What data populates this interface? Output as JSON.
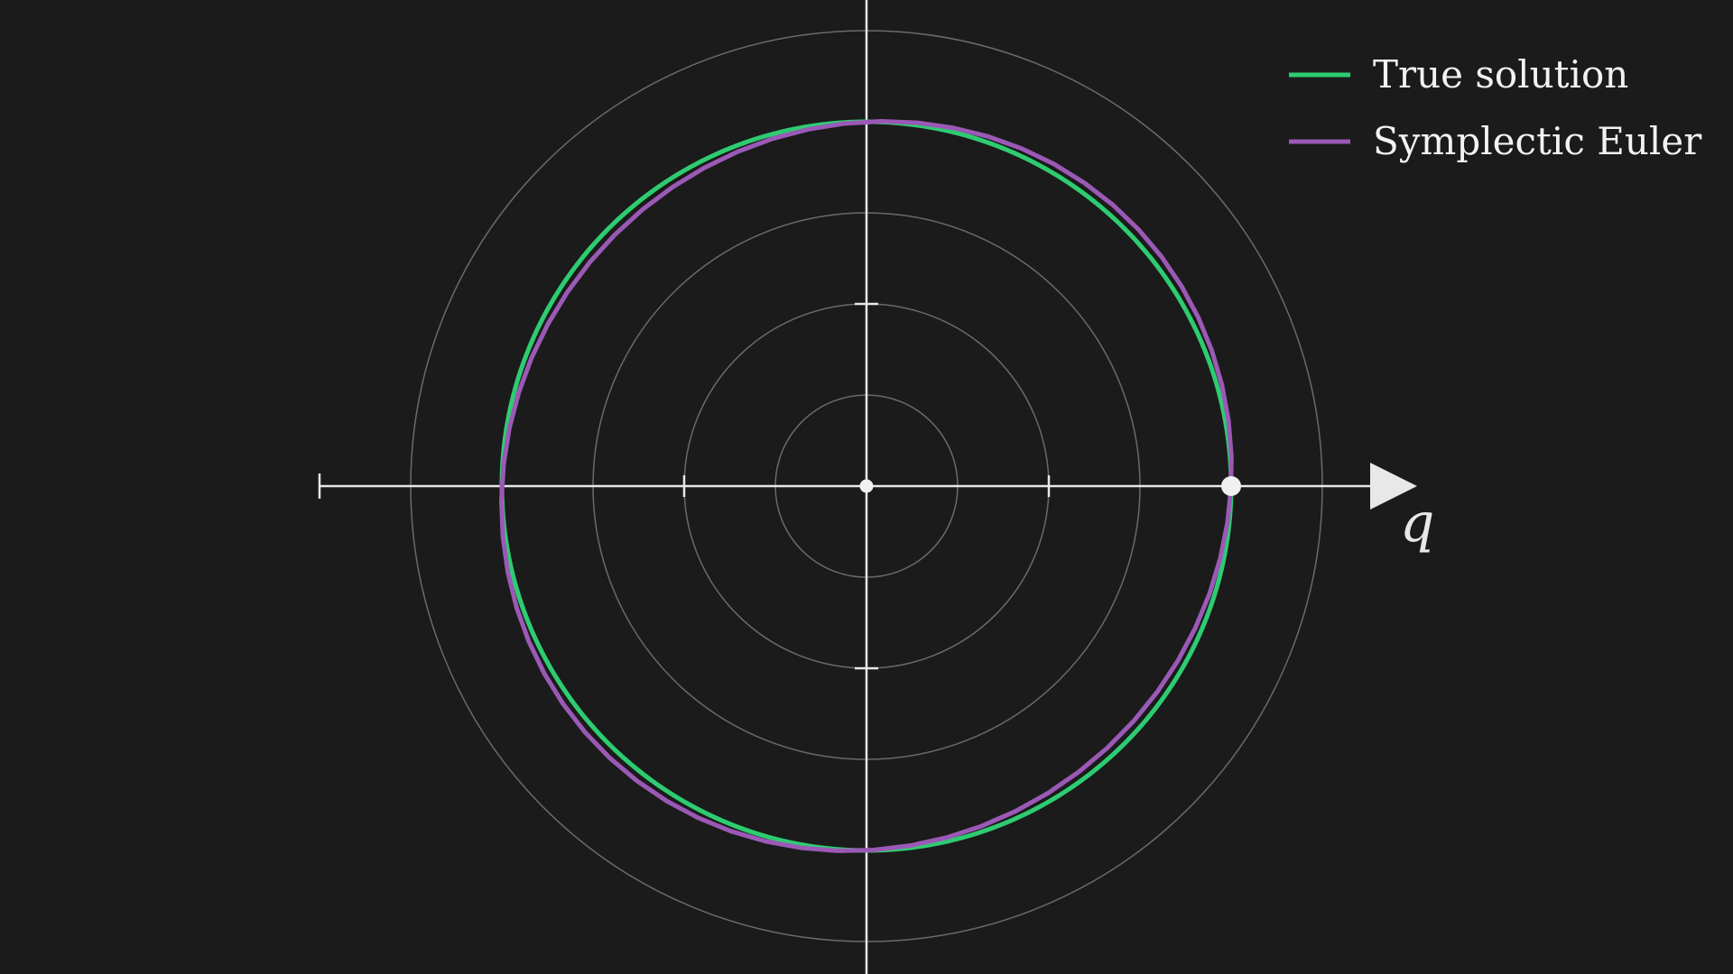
{
  "chart_data": {
    "type": "line",
    "title": "",
    "xlabel": "q",
    "ylabel": "",
    "xlim": [
      -3,
      3
    ],
    "ylim": [
      -2.7,
      2.7
    ],
    "grid": "polar",
    "grid_radii": [
      0.5,
      1.0,
      1.5,
      2.0,
      2.5
    ],
    "x_ticks": [
      -3,
      -1,
      1
    ],
    "y_ticks": [
      -1,
      1
    ],
    "legend_position": "top-right",
    "series": [
      {
        "name": "True solution",
        "color": "#2ecc71",
        "curve": "circle",
        "radius": 2.0
      },
      {
        "name": "Symplectic Euler",
        "color": "#9b59b6",
        "curve": "symplectic-euler",
        "h": 0.1,
        "steps": 63,
        "start": [
          2.0,
          0.0
        ]
      }
    ],
    "markers": [
      {
        "label": "origin",
        "x": 0,
        "y": 0,
        "color": "#f0f0f0"
      },
      {
        "label": "initial point",
        "x": 2,
        "y": 0,
        "color": "#f0f0f0"
      }
    ]
  },
  "colors": {
    "background": "#1b1b1b",
    "axis": "#e8e8e8",
    "grid": "#6a6a6a",
    "legend_text": "#f2f2f2"
  }
}
